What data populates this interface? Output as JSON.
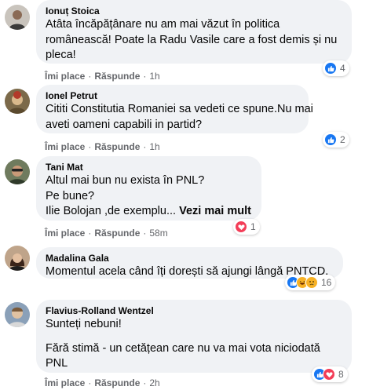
{
  "labels": {
    "like": "Îmi place",
    "reply": "Răspunde",
    "separator": "·"
  },
  "colors": {
    "bubble": "#f0f2f5",
    "like": "#1877f2",
    "love": "#f33e58",
    "haha": "#f7b125",
    "meta": "#65676b"
  },
  "comments": [
    {
      "author": "Ionuț Stoica",
      "lines": [
        "Atâta încăpățânare nu am mai văzut în politica",
        "românească! Poate la Radu Vasile care a fost demis și nu",
        "pleca!"
      ],
      "time": "1h",
      "reactions": [
        "like-icon"
      ],
      "reaction_count": "4"
    },
    {
      "author": "Ionel Petrut",
      "lines": [
        "Cititi Constitutia Romaniei sa vedeti ce spune.Nu mai",
        "aveti oameni capabili in partid?"
      ],
      "time": "1h",
      "reactions": [
        "like-icon"
      ],
      "reaction_count": "2"
    },
    {
      "author": "Tani Mat",
      "lines": [
        "Altul mai bun nu exista în PNL?",
        "Pe bune?",
        "Ilie Bolojan ,de exemplu..."
      ],
      "see_more": "Vezi mai mult",
      "time": "58m",
      "reactions": [
        "love-icon"
      ],
      "reaction_count": "1"
    },
    {
      "author": "Madalina Gala",
      "lines": [
        "Momentul acela când îți dorești să ajungi lângă PNTCD."
      ],
      "time": "",
      "reactions": [
        "like-icon",
        "haha-icon",
        "sad-icon"
      ],
      "reaction_count": "16"
    },
    {
      "author": "Flavius-Rolland Wentzel",
      "lines": [
        "Sunteți nebuni!",
        "Fără stimă - un cetățean care nu va mai vota niciodată",
        "PNL"
      ],
      "time": "2h",
      "reactions": [
        "like-icon",
        "love-icon"
      ],
      "reaction_count": "8"
    }
  ]
}
